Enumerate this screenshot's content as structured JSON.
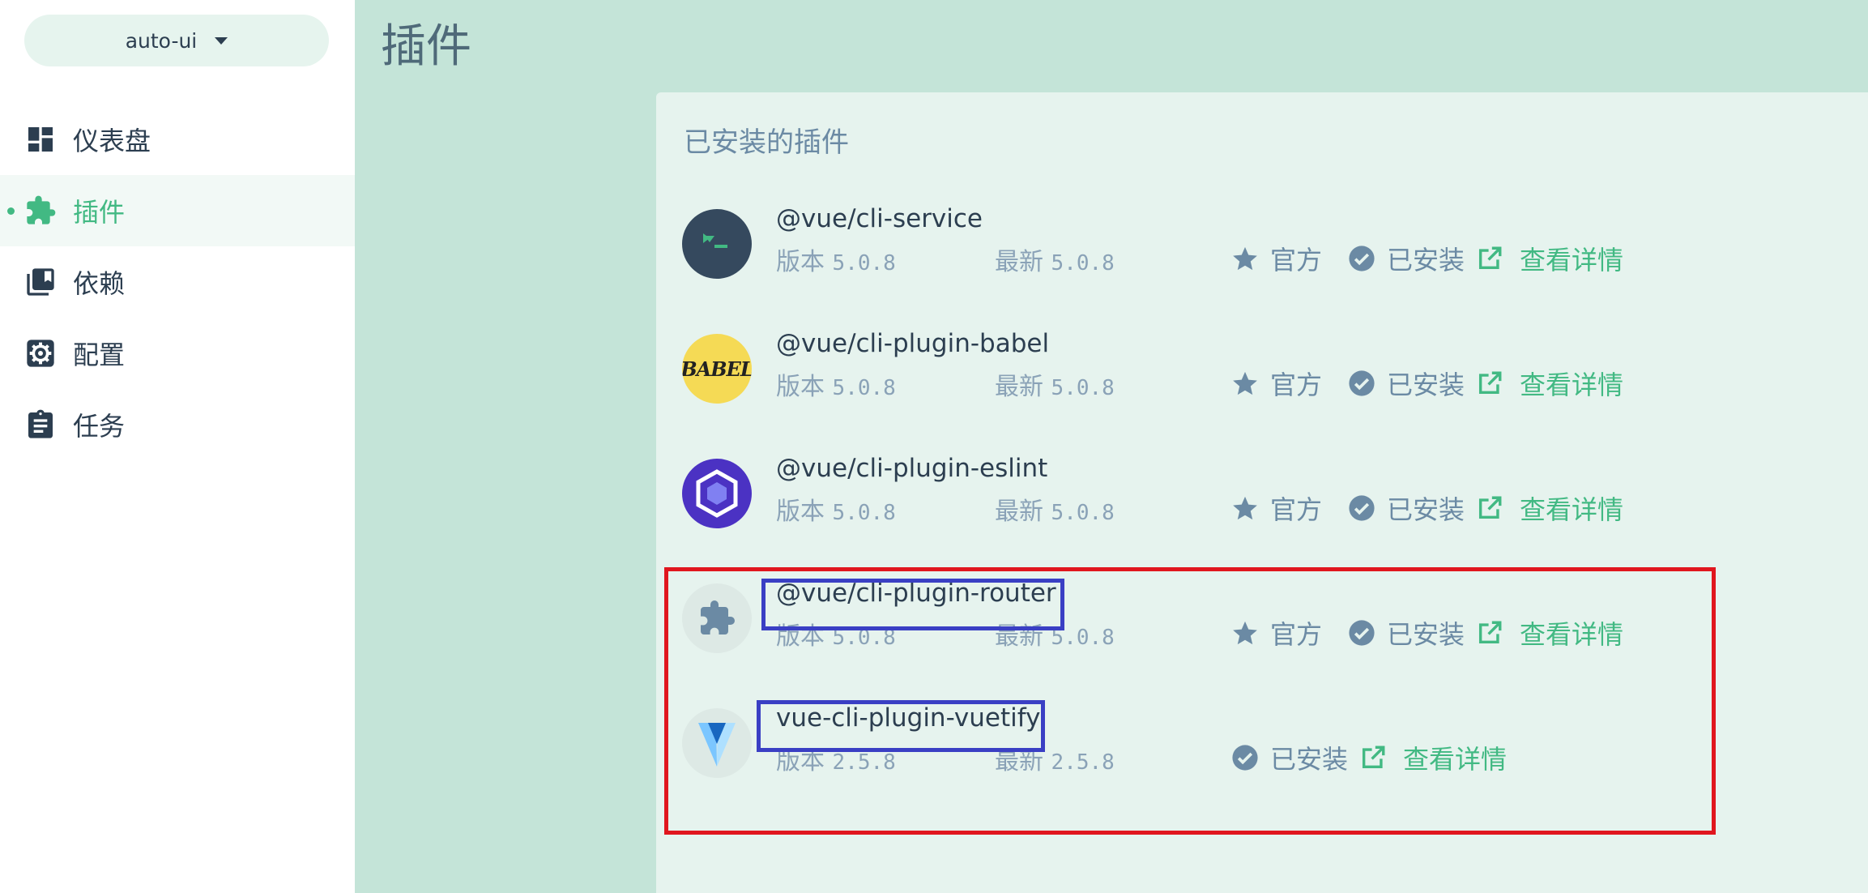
{
  "project": {
    "name": "auto-ui"
  },
  "sidebar": {
    "items": [
      {
        "label": "仪表盘",
        "icon": "dashboard-icon",
        "active": false
      },
      {
        "label": "插件",
        "icon": "puzzle-icon",
        "active": true
      },
      {
        "label": "依赖",
        "icon": "library-icon",
        "active": false
      },
      {
        "label": "配置",
        "icon": "gear-icon",
        "active": false
      },
      {
        "label": "任务",
        "icon": "clipboard-icon",
        "active": false
      }
    ]
  },
  "page": {
    "title": "插件"
  },
  "panel": {
    "title": "已安装的插件"
  },
  "labels": {
    "version": "版本",
    "latest": "最新",
    "official": "官方",
    "installed": "已安装",
    "details": "查看详情"
  },
  "plugins": [
    {
      "name": "@vue/cli-service",
      "version": "5.0.8",
      "latest": "5.0.8",
      "official": true,
      "logo": "vue-cli-terminal-icon"
    },
    {
      "name": "@vue/cli-plugin-babel",
      "version": "5.0.8",
      "latest": "5.0.8",
      "official": true,
      "logo": "babel-logo-icon",
      "logo_text": "BABEL"
    },
    {
      "name": "@vue/cli-plugin-eslint",
      "version": "5.0.8",
      "latest": "5.0.8",
      "official": true,
      "logo": "eslint-logo-icon"
    },
    {
      "name": "@vue/cli-plugin-router",
      "version": "5.0.8",
      "latest": "5.0.8",
      "official": true,
      "logo": "puzzle-icon"
    },
    {
      "name": "vue-cli-plugin-vuetify",
      "version": "2.5.8",
      "latest": "2.5.8",
      "official": false,
      "logo": "vuetify-logo-icon"
    }
  ],
  "colors": {
    "accent": "#42b983",
    "background": "#c4e4d8",
    "panel": "#e6f3ee",
    "muted": "#8aa2b7",
    "highlight_red": "#e0161e",
    "highlight_blue": "#3a3fc4"
  }
}
